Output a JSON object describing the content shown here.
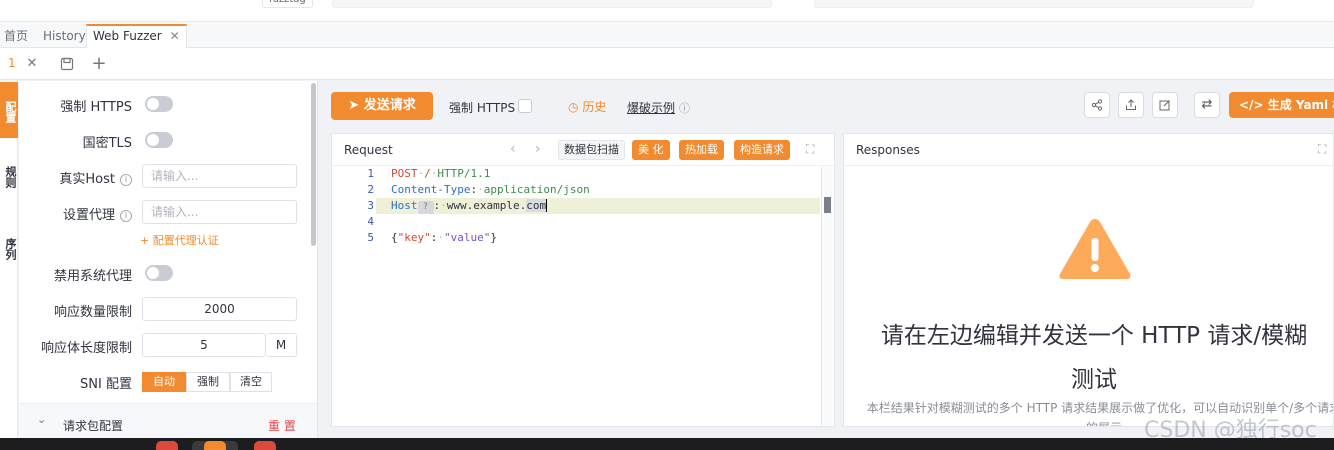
{
  "colors": {
    "accent": "#f28b30",
    "warning": "#fdaa5a"
  },
  "topstrip": {
    "tag_label": "fuzztag"
  },
  "page_tabs": {
    "home": "首页",
    "history": "History",
    "fuzzer": "Web Fuzzer",
    "close_glyph": "✕"
  },
  "sub_tabs": {
    "number": "1",
    "close_glyph": "✕",
    "save_glyph": "▣",
    "add_glyph": "+"
  },
  "rail": {
    "item1": "配置",
    "item2": "规则",
    "item3": "序列"
  },
  "config": {
    "force_https_label": "强制 HTTPS",
    "gm_tls_label": "国密TLS",
    "real_host_label": "真实Host",
    "real_host_placeholder": "请输入...",
    "proxy_label": "设置代理",
    "proxy_placeholder": "请输入...",
    "proxy_auth_link": "+ 配置代理认证",
    "disable_sys_proxy_label": "禁用系统代理",
    "resp_count_label": "响应数量限制",
    "resp_count_value": "2000",
    "resp_len_label": "响应体长度限制",
    "resp_len_value": "5",
    "resp_len_unit": "M",
    "sni_label": "SNI 配置",
    "sni_options": [
      "自动",
      "强制",
      "清空"
    ],
    "sni_selected": "自动",
    "packet_section_label": "请求包配置",
    "reset_label": "重 置",
    "info_glyph": "i"
  },
  "toolbar": {
    "send_label": "发送请求",
    "force_https_label": "强制 HTTPS",
    "history_label": "历史",
    "example_label": "爆破示例",
    "yaml_label": "生成 Yaml 模板"
  },
  "request": {
    "title": "Request",
    "scan_label": "数据包扫描",
    "beautify_label": "美 化",
    "hot_reload_label": "热加载",
    "build_label": "构造请求",
    "line_numbers": [
      "1",
      "2",
      "3",
      "4",
      "5"
    ],
    "method": "POST",
    "path": "/",
    "protocol": "HTTP/1.1",
    "header1_name": "Content-Type",
    "header1_value": "application/json",
    "header2_name": "Host",
    "header2_value_a": "www.example.",
    "header2_value_b": "com",
    "body_key": "\"key\"",
    "body_value": "\"value\""
  },
  "responses": {
    "title": "Responses",
    "message": "请在左边编辑并发送一个 HTTP 请求/模糊测试",
    "description": "本栏结果针对模糊测试的多个 HTTP 请求结果展示做了优化，可以自动识别单个/多个请求的展示"
  },
  "watermark": "CSDN @独行soc"
}
